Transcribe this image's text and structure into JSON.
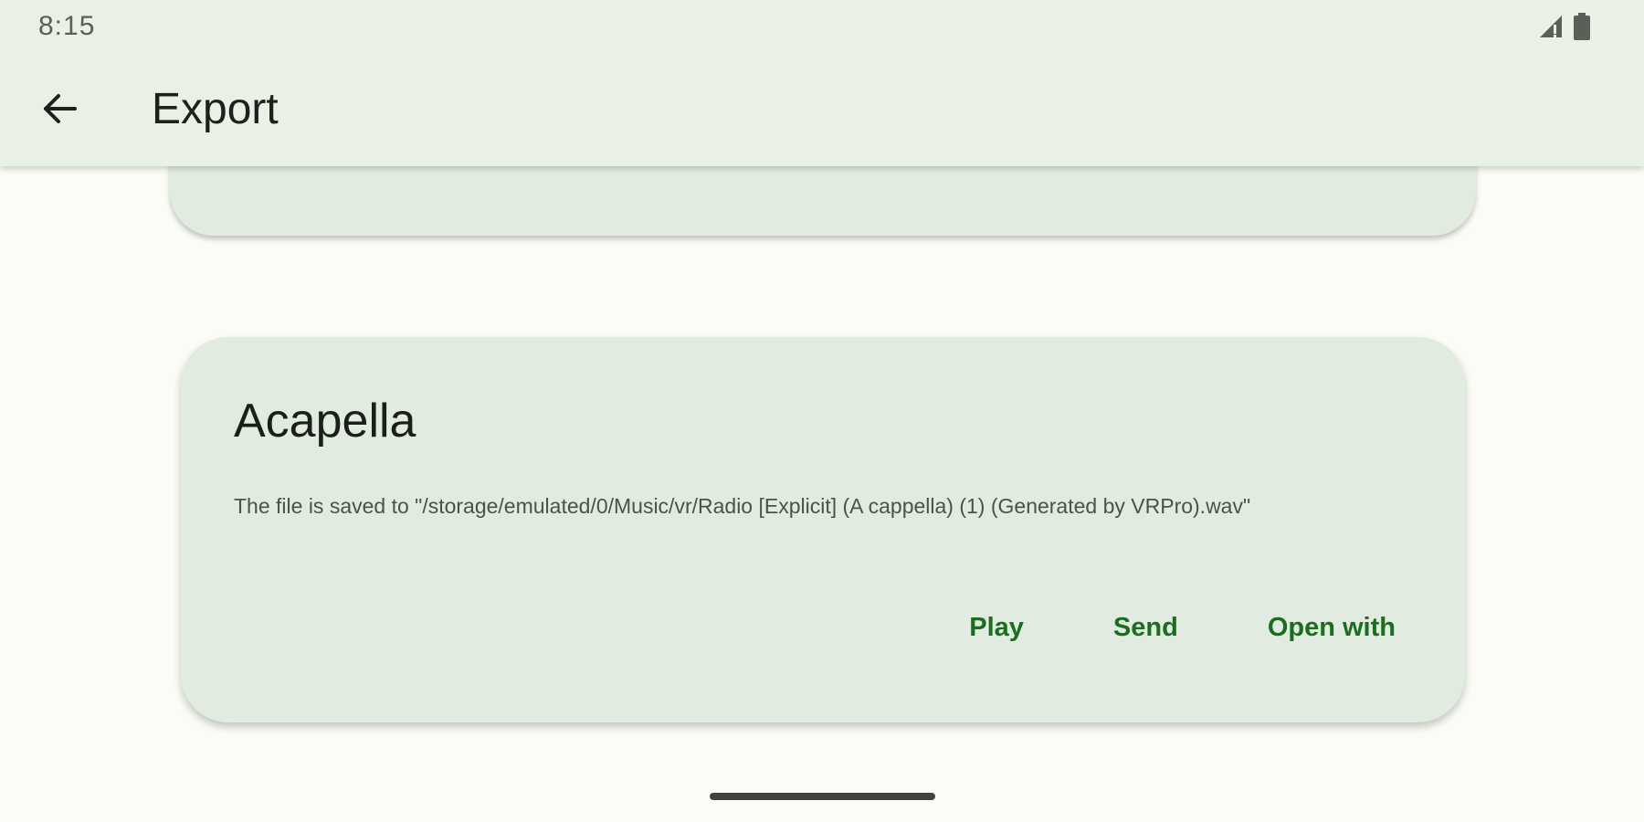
{
  "status_bar": {
    "time": "8:15",
    "icons": [
      "signal-icon",
      "battery-icon"
    ]
  },
  "app_bar": {
    "back_icon": "arrow-back-icon",
    "title": "Export"
  },
  "card": {
    "title": "Acapella",
    "description": "The file is saved to \"/storage/emulated/0/Music/vr/Radio [Explicit] (A cappella) (1) (Generated by VRPro).wav\"",
    "actions": {
      "play": "Play",
      "send": "Send",
      "open_with": "Open with"
    }
  },
  "colors": {
    "accent": "#1b6d1f",
    "app_bar_bg": "#e9f0e6",
    "card_bg": "#e2ebdf",
    "page_bg": "#fbfcf6"
  }
}
